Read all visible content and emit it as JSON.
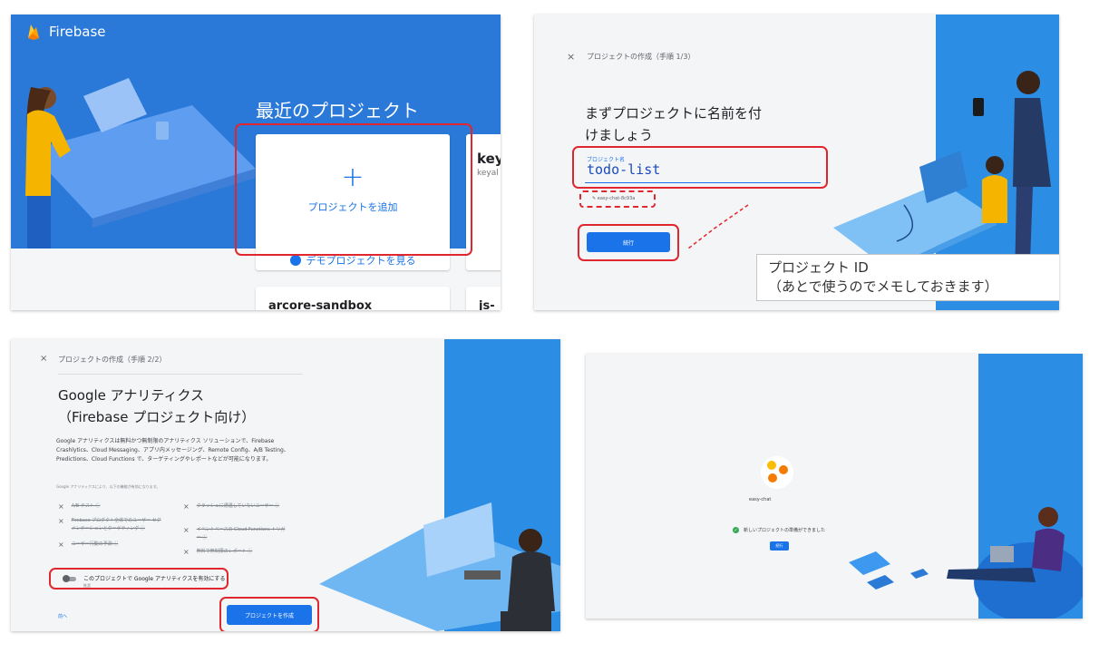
{
  "colors": {
    "firebase_blue": "#2a79d9",
    "accent": "#1a73e8",
    "highlight_red": "#e0262e",
    "illustration_blue": "#2b8de4"
  },
  "panel1": {
    "brand": "Firebase",
    "recent_projects_title": "最近のプロジェクト",
    "add_project_icon": "+",
    "add_project_label": "プロジェクトを追加",
    "demo_project_label": "デモプロジェクトを見る",
    "project_card_title": "key",
    "project_card_subtitle": "keyal",
    "bottom_card_1": "arcore-sandbox",
    "bottom_card_2": "js-"
  },
  "panel2": {
    "close_icon": "×",
    "step_label": "プロジェクトの作成（手順 1/3）",
    "heading_line1": "まずプロジェクトに名前を付",
    "heading_line2": "けましょう",
    "field_label": "プロジェクト名",
    "field_value": "todo-list",
    "project_id": "easy-chat-8c93a",
    "continue_button": "続行",
    "callout_line1": "プロジェクト ID",
    "callout_line2": "（あとで使うのでメモしておきます）"
  },
  "panel3": {
    "close_icon": "×",
    "step_label": "プロジェクトの作成（手順 2/2）",
    "title_line1": "Google アナリティクス",
    "title_line2": "（Firebase プロジェクト向け）",
    "description": "Google アナリティクスは無料かつ無制限のアナリティクス ソリューションで、Firebase Crashlytics、Cloud Messaging、アプリ内メッセージング、Remote Config、A/B Testing、Predictions、Cloud Functions で、ターゲティングやレポートなどが可能になります。",
    "features_heading": "Google アナリティクスにより、以下の機能が有効になります。",
    "features": [
      "A/B テスト ⓘ",
      "クラッシュに遭遇していないユーザー ⓘ",
      "Firebase プロダクト全体でのユーザー セグメンテーションとターゲティング ⓘ",
      "イベントベースの Cloud Functions トリガー ⓘ",
      "ユーザー行動の予測 ⓘ",
      "無料で無制限のレポート ⓘ"
    ],
    "toggle_label": "このプロジェクトで Google アナリティクスを有効にする",
    "toggle_sub": "推奨",
    "back_link": "前へ",
    "create_button": "プロジェクトを作成"
  },
  "panel4": {
    "project_name": "easy-chat",
    "status_text": "新しいプロジェクトの準備ができました",
    "continue_button": "続行"
  }
}
